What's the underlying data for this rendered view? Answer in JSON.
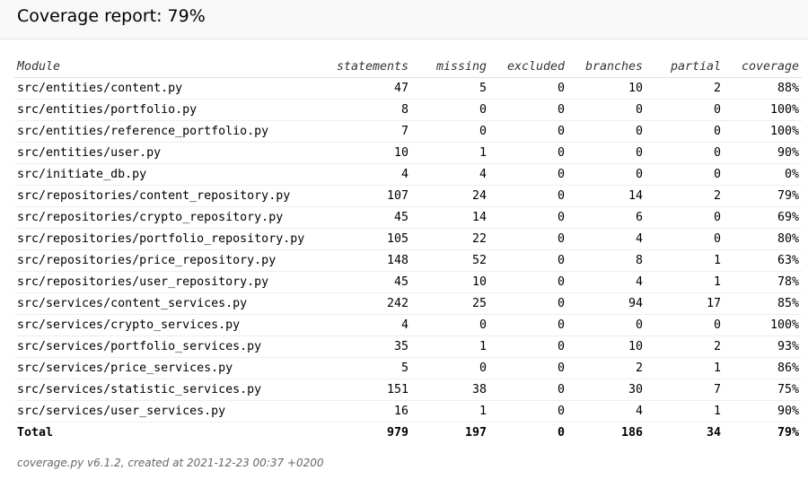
{
  "header": {
    "title": "Coverage report: 79%"
  },
  "table": {
    "columns": [
      "Module",
      "statements",
      "missing",
      "excluded",
      "branches",
      "partial",
      "coverage"
    ],
    "rows": [
      [
        "src/entities/content.py",
        "47",
        "5",
        "0",
        "10",
        "2",
        "88%"
      ],
      [
        "src/entities/portfolio.py",
        "8",
        "0",
        "0",
        "0",
        "0",
        "100%"
      ],
      [
        "src/entities/reference_portfolio.py",
        "7",
        "0",
        "0",
        "0",
        "0",
        "100%"
      ],
      [
        "src/entities/user.py",
        "10",
        "1",
        "0",
        "0",
        "0",
        "90%"
      ],
      [
        "src/initiate_db.py",
        "4",
        "4",
        "0",
        "0",
        "0",
        "0%"
      ],
      [
        "src/repositories/content_repository.py",
        "107",
        "24",
        "0",
        "14",
        "2",
        "79%"
      ],
      [
        "src/repositories/crypto_repository.py",
        "45",
        "14",
        "0",
        "6",
        "0",
        "69%"
      ],
      [
        "src/repositories/portfolio_repository.py",
        "105",
        "22",
        "0",
        "4",
        "0",
        "80%"
      ],
      [
        "src/repositories/price_repository.py",
        "148",
        "52",
        "0",
        "8",
        "1",
        "63%"
      ],
      [
        "src/repositories/user_repository.py",
        "45",
        "10",
        "0",
        "4",
        "1",
        "78%"
      ],
      [
        "src/services/content_services.py",
        "242",
        "25",
        "0",
        "94",
        "17",
        "85%"
      ],
      [
        "src/services/crypto_services.py",
        "4",
        "0",
        "0",
        "0",
        "0",
        "100%"
      ],
      [
        "src/services/portfolio_services.py",
        "35",
        "1",
        "0",
        "10",
        "2",
        "93%"
      ],
      [
        "src/services/price_services.py",
        "5",
        "0",
        "0",
        "2",
        "1",
        "86%"
      ],
      [
        "src/services/statistic_services.py",
        "151",
        "38",
        "0",
        "30",
        "7",
        "75%"
      ],
      [
        "src/services/user_services.py",
        "16",
        "1",
        "0",
        "4",
        "1",
        "90%"
      ]
    ],
    "total": [
      "Total",
      "979",
      "197",
      "0",
      "186",
      "34",
      "79%"
    ]
  },
  "footer": {
    "text": "coverage.py v6.1.2, created at 2021-12-23 00:37 +0200"
  }
}
